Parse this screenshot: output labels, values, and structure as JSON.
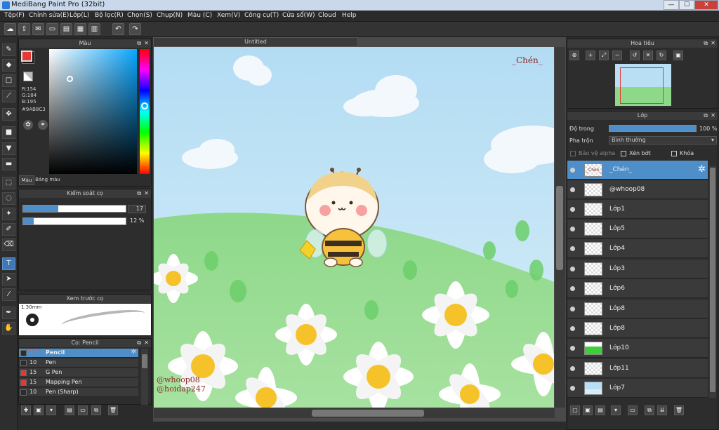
{
  "window": {
    "title": "MediBang Paint Pro (32bit)",
    "minimize": "—",
    "maximize": "☐",
    "close": "✕"
  },
  "menu": [
    "Tệp(F)",
    "Chỉnh sửa(E)",
    "Lớp(L)",
    "Bộ lọc(R)",
    "Chọn(S)",
    "Chụp(N)",
    "Màu (C)",
    "Xem(V)",
    "Công cụ(T)",
    "Cửa sổ(W)",
    "Cloud",
    "Help"
  ],
  "toolbar_icons": [
    "cloud-icon",
    "upload-icon",
    "chat-icon",
    "comic-icon",
    "page-icon",
    "grid-icon",
    "layout-icon",
    "undo-icon",
    "redo-icon"
  ],
  "tools": [
    "brush-icon",
    "eraser-icon",
    "rect-icon",
    "line-icon",
    "move-icon",
    "fill-rect-icon",
    "bucket-icon",
    "gradient-icon",
    "select-rect-icon",
    "lasso-icon",
    "magic-wand-icon",
    "select-pen-icon",
    "select-eraser-icon",
    "text-icon",
    "operation-icon",
    "eyedropper-icon",
    "dropper-icon",
    "hand-icon"
  ],
  "color_panel": {
    "title": "Màu",
    "r": "R:154",
    "g": "G:184",
    "b": "B:195",
    "hex": "#9AB8C3",
    "tab_color": "Màu",
    "tab_palette": "Bảng màu"
  },
  "brush_control": {
    "title": "Kiểm soát cọ",
    "size_value": "17",
    "opacity_value": "12 %",
    "size_fraction": 0.34,
    "opacity_fraction": 0.1
  },
  "brush_preview": {
    "title": "Xem trước cọ",
    "size_label": "1.30mm"
  },
  "brush_list": {
    "title": "Cọ: Pencil",
    "items": [
      {
        "size": "17",
        "name": "Pencil",
        "color": "#2c2c2c",
        "selected": true
      },
      {
        "size": "10",
        "name": "Pen",
        "color": "#2c2c2c",
        "selected": false
      },
      {
        "size": "15",
        "name": "G Pen",
        "color": "#e53935",
        "selected": false
      },
      {
        "size": "15",
        "name": "Mapping Pen",
        "color": "#e53935",
        "selected": false
      },
      {
        "size": "10",
        "name": "Pen (Sharp)",
        "color": "#2c2c2c",
        "selected": false
      }
    ]
  },
  "document": {
    "tab_title": "Untitled",
    "signature_top": "_Chén_",
    "signature_bottom_1": "@whoop08",
    "signature_bottom_2": "@hoidap247"
  },
  "navigator": {
    "title": "Hoa tiêu"
  },
  "layers_panel": {
    "title": "Lớp",
    "opacity_label": "Độ trong",
    "opacity_value": "100 %",
    "opacity_fraction": 1.0,
    "blend_label": "Pha trộn",
    "blend_value": "Bình thường",
    "protect_alpha": "Bảo vệ alpha",
    "clipping": "Xén bớt",
    "lock": "Khóa",
    "layers": [
      {
        "name": "_Chén_",
        "selected": true
      },
      {
        "name": "@whoop08",
        "selected": false
      },
      {
        "name": "Lớp1",
        "selected": false
      },
      {
        "name": "Lớp5",
        "selected": false
      },
      {
        "name": "Lớp4",
        "selected": false
      },
      {
        "name": "Lớp3",
        "selected": false
      },
      {
        "name": "Lớp6",
        "selected": false
      },
      {
        "name": "Lớp8",
        "selected": false
      },
      {
        "name": "Lớp8",
        "selected": false
      },
      {
        "name": "Lớp10",
        "selected": false
      },
      {
        "name": "Lớp11",
        "selected": false
      },
      {
        "name": "Lớp7",
        "selected": false
      }
    ]
  },
  "colors": {
    "accent": "#4f8fc9",
    "foreground": "#e53935",
    "background": "#111111"
  }
}
